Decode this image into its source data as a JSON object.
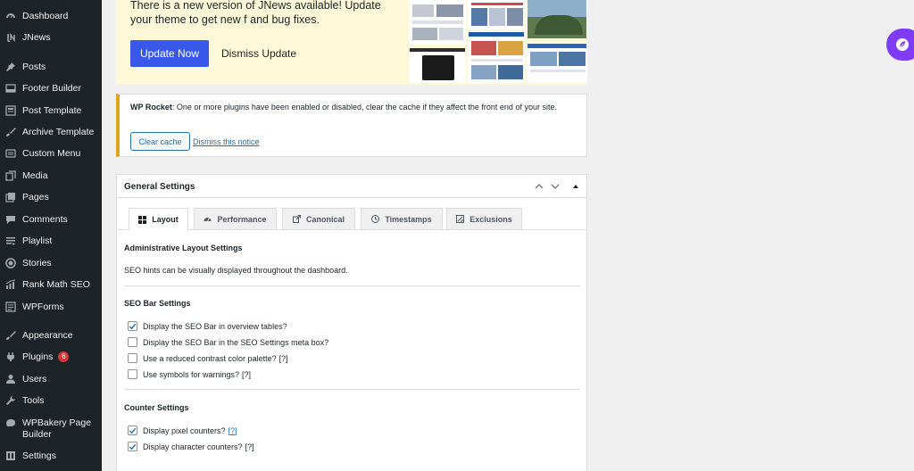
{
  "sidebar": {
    "items": [
      {
        "label": "Dashboard",
        "icon": "dashboard-icon"
      },
      {
        "label": "JNews",
        "icon": "jnews-icon"
      },
      {
        "label": "Posts",
        "icon": "pin-icon"
      },
      {
        "label": "Footer Builder",
        "icon": "footer-icon"
      },
      {
        "label": "Post Template",
        "icon": "template-icon"
      },
      {
        "label": "Archive Template",
        "icon": "brush-icon"
      },
      {
        "label": "Custom Menu",
        "icon": "menu-icon"
      },
      {
        "label": "Media",
        "icon": "media-icon"
      },
      {
        "label": "Pages",
        "icon": "pages-icon"
      },
      {
        "label": "Comments",
        "icon": "comment-icon"
      },
      {
        "label": "Playlist",
        "icon": "playlist-icon"
      },
      {
        "label": "Stories",
        "icon": "stories-icon"
      },
      {
        "label": "Rank Math SEO",
        "icon": "chart-icon"
      },
      {
        "label": "WPForms",
        "icon": "forms-icon"
      },
      {
        "label": "Appearance",
        "icon": "appearance-icon"
      },
      {
        "label": "Plugins",
        "icon": "plugin-icon",
        "badge": "6"
      },
      {
        "label": "Users",
        "icon": "users-icon"
      },
      {
        "label": "Tools",
        "icon": "tools-icon"
      },
      {
        "label": "WPBakery Page Builder",
        "icon": "wpbakery-icon"
      },
      {
        "label": "Settings",
        "icon": "settings-icon"
      }
    ]
  },
  "jnews_notice": {
    "text_before": "There is a new version of JNews available! Update your theme to get new f",
    "text_after": "and bug fixes.",
    "update_button": "Update Now",
    "dismiss": "Dismiss Update"
  },
  "rocket_notice": {
    "brand": "WP Rocket",
    "message": ": One or more plugins have been enabled or disabled, clear the cache if they affect the front end of your site.",
    "clear_button": "Clear cache",
    "dismiss_link": "Dismiss this notice"
  },
  "general_settings": {
    "title": "General Settings",
    "tabs": [
      {
        "label": "Layout",
        "icon": "layout-icon",
        "active": true
      },
      {
        "label": "Performance",
        "icon": "performance-icon",
        "active": false
      },
      {
        "label": "Canonical",
        "icon": "canonical-icon",
        "active": false
      },
      {
        "label": "Timestamps",
        "icon": "clock-icon",
        "active": false
      },
      {
        "label": "Exclusions",
        "icon": "exclusions-icon",
        "active": false
      }
    ],
    "admin_layout": {
      "title": "Administrative Layout Settings",
      "description": "SEO hints can be visually displayed throughout the dashboard."
    },
    "seo_bar": {
      "title": "SEO Bar Settings",
      "options": [
        {
          "label": "Display the SEO Bar in overview tables?",
          "checked": true,
          "help": ""
        },
        {
          "label": "Display the SEO Bar in the SEO Settings meta box?",
          "checked": false,
          "help": ""
        },
        {
          "label": "Use a reduced contrast color palette?",
          "checked": false,
          "help": "[?]"
        },
        {
          "label": "Use symbols for warnings?",
          "checked": false,
          "help": "[?]"
        }
      ]
    },
    "counter": {
      "title": "Counter Settings",
      "options": [
        {
          "label": "Display pixel counters?",
          "checked": true,
          "help": "[?]",
          "help_link": true
        },
        {
          "label": "Display character counters?",
          "checked": true,
          "help": "[?]",
          "help_link": false
        }
      ]
    }
  },
  "colors": {
    "sidebar_bg": "#1d2327",
    "primary": "#3858e9",
    "link": "#2271b1",
    "warning_border": "#dba617",
    "float_button": "#7f3bf5"
  }
}
